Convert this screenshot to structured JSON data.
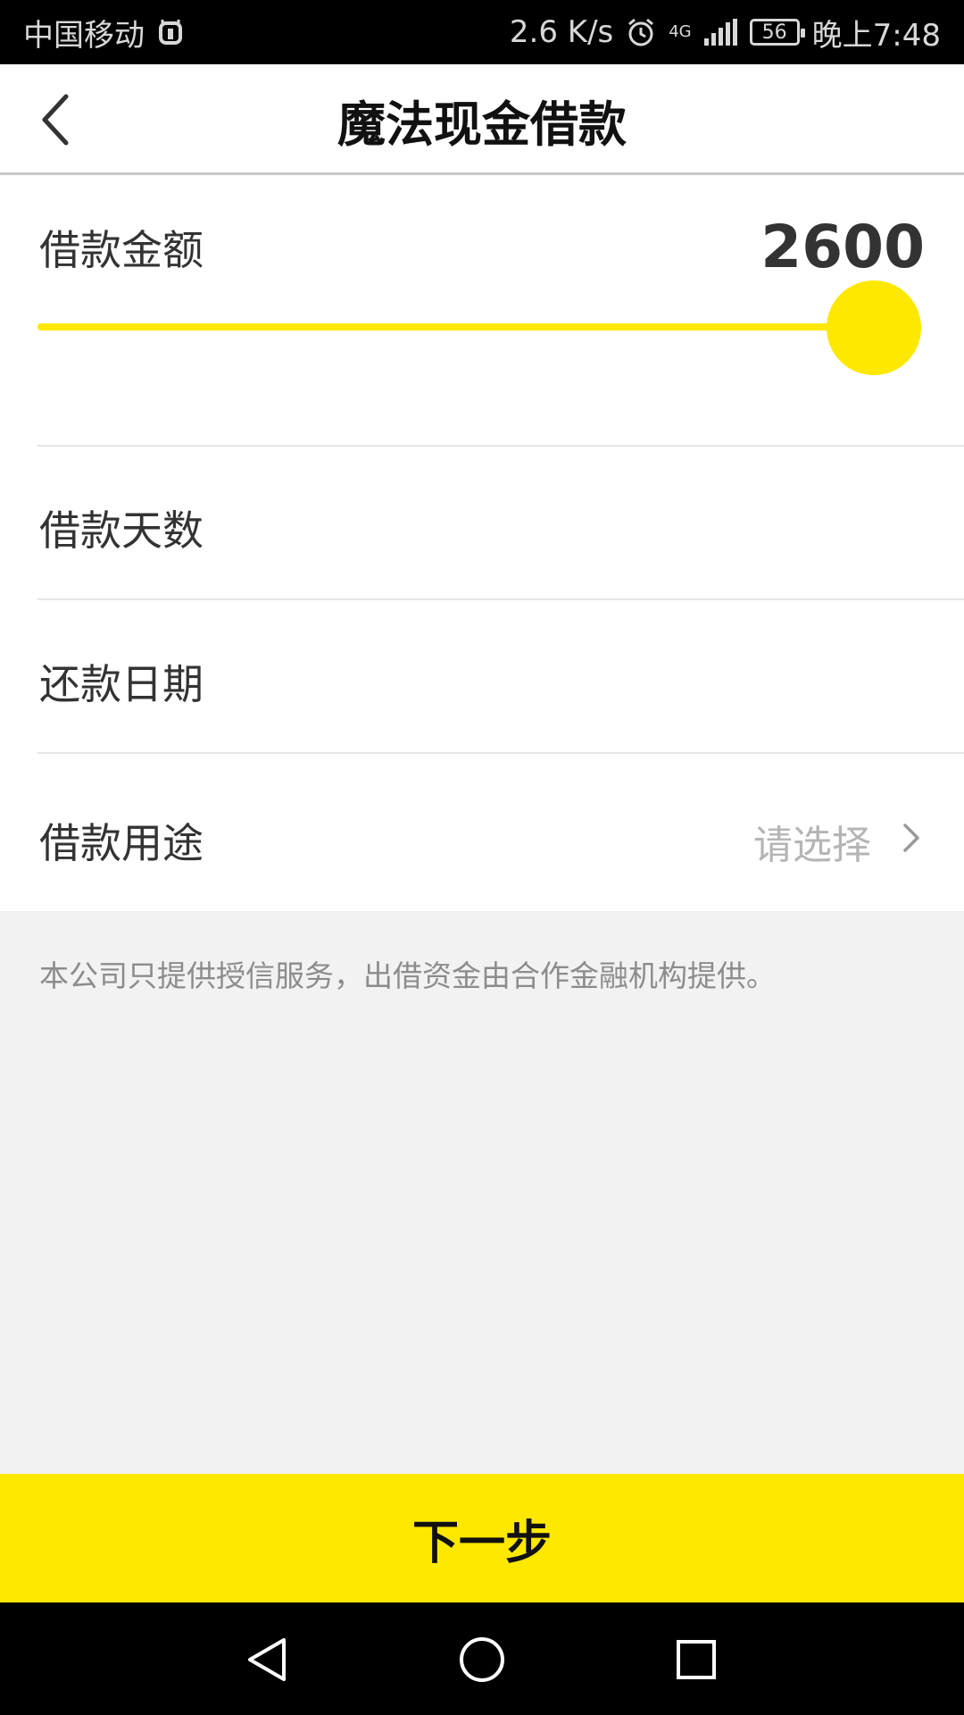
{
  "status_bar": {
    "carrier": "中国移动",
    "speed": "2.6 K/s",
    "network": "4G",
    "battery": "56",
    "time": "晚上7:48"
  },
  "header": {
    "title": "魔法现金借款"
  },
  "loan_amount": {
    "label": "借款金额",
    "value": "2600",
    "slider_fraction": 1.0
  },
  "loan_days": {
    "label": "借款天数"
  },
  "repay_date": {
    "label": "还款日期"
  },
  "loan_purpose": {
    "label": "借款用途",
    "placeholder": "请选择"
  },
  "notice": "本公司只提供授信服务，出借资金由合作金融机构提供。",
  "next_button": {
    "label": "下一步"
  },
  "colors": {
    "accent": "#ffe800",
    "text_primary": "#333333",
    "text_muted": "#b5b5b5",
    "background_gray": "#f2f2f2"
  }
}
